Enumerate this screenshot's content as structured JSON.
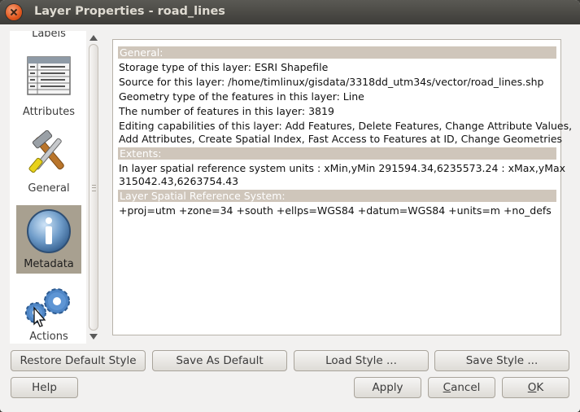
{
  "window": {
    "title": "Layer Properties - road_lines"
  },
  "sidebar": {
    "items": [
      {
        "label": "Labels",
        "icon": "labels-icon",
        "selected": false
      },
      {
        "label": "Attributes",
        "icon": "table-icon",
        "selected": false
      },
      {
        "label": "General",
        "icon": "tools-icon",
        "selected": false
      },
      {
        "label": "Metadata",
        "icon": "info-icon",
        "selected": true
      },
      {
        "label": "Actions",
        "icon": "gears-icon",
        "selected": false
      }
    ]
  },
  "metadata": {
    "general_header": "General:",
    "storage_type": "Storage type of this layer: ESRI Shapefile",
    "source": "Source for this layer: /home/timlinux/gisdata/3318dd_utm34s/vector/road_lines.shp",
    "geometry_type": "Geometry type of the features in this layer: Line",
    "feature_count": "The number of features in this layer: 3819",
    "editing_line1": "Editing capabilities of this layer: Add Features, Delete Features, Change Attribute Values,",
    "editing_line2": "Add Attributes, Create Spatial Index, Fast Access to Features at ID, Change Geometries",
    "extents_header": "Extents:",
    "extents_line1": "In layer spatial reference system units : xMin,yMin 291594.34,6235573.24 : xMax,yMax",
    "extents_line2": "315042.43,6263754.43",
    "srs_header": "Layer Spatial Reference System:",
    "srs_value": "+proj=utm +zone=34 +south +ellps=WGS84 +datum=WGS84 +units=m +no_defs"
  },
  "buttons": {
    "restore_default_style": "Restore Default Style",
    "save_as_default": "Save As Default",
    "load_style": "Load Style ...",
    "save_style": "Save Style ...",
    "help": "Help",
    "apply": "Apply",
    "cancel_pre": "",
    "cancel_mnemonic": "C",
    "cancel_post": "ancel",
    "ok_pre": "",
    "ok_mnemonic": "O",
    "ok_post": "K"
  },
  "colors": {
    "section_header_bg": "#cfc6bb",
    "selected_item_bg": "#a8a090",
    "titlebar_bg": "#3d3c38"
  }
}
